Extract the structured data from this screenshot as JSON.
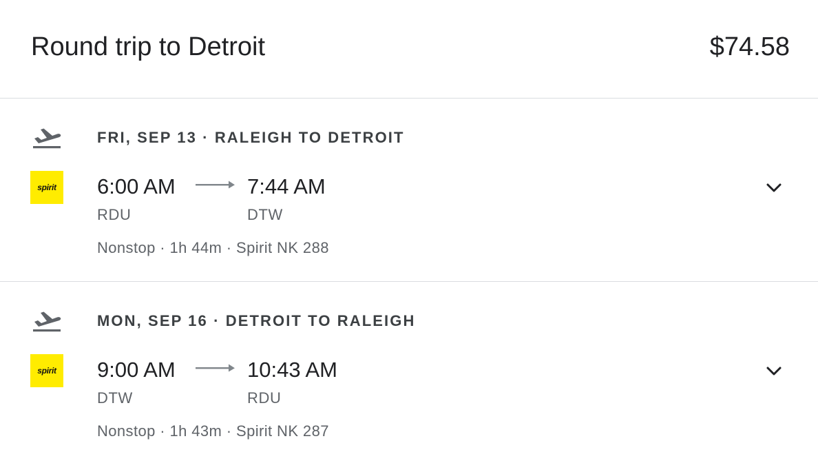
{
  "trip": {
    "title": "Round trip to Detroit",
    "price": "$74.58"
  },
  "legs": [
    {
      "icon": "flight-takeoff-icon",
      "date": "FRI, SEP 13",
      "route": "RALEIGH TO DETROIT",
      "header": "FRI, SEP 13 · RALEIGH TO DETROIT",
      "airline_logo_text": "spirit",
      "depart_time": "6:00 AM",
      "arrive_time": "7:44 AM",
      "depart_code": "RDU",
      "arrive_code": "DTW",
      "details": "Nonstop · 1h 44m · Spirit NK 288"
    },
    {
      "icon": "flight-takeoff-icon",
      "date": "MON, SEP 16",
      "route": "DETROIT TO RALEIGH",
      "header": "MON, SEP 16 · DETROIT TO RALEIGH",
      "airline_logo_text": "spirit",
      "depart_time": "9:00 AM",
      "arrive_time": "10:43 AM",
      "depart_code": "DTW",
      "arrive_code": "RDU",
      "details": "Nonstop · 1h 43m · Spirit NK 287"
    }
  ],
  "colors": {
    "logo_yellow": "#ffec00",
    "text_primary": "#202124",
    "text_secondary": "#5f6368",
    "divider": "#dadce0"
  }
}
